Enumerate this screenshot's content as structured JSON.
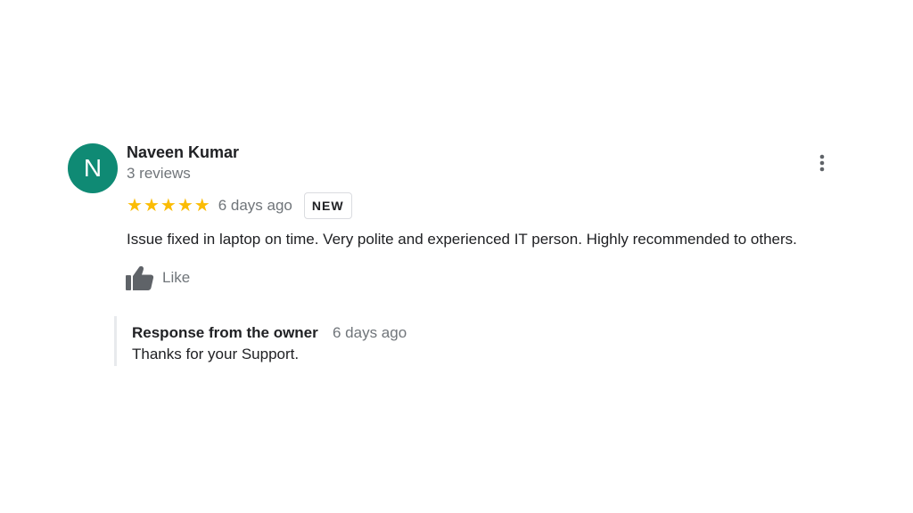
{
  "review": {
    "author": {
      "initial": "N",
      "name": "Naveen Kumar",
      "review_count": "3 reviews",
      "avatar_color": "#0f8a74"
    },
    "rating": {
      "stars": 5,
      "max": 5,
      "star_glyph": "★",
      "star_color": "#fbbc04"
    },
    "time_ago": "6 days ago",
    "badge": "NEW",
    "text": "Issue fixed in laptop on time. Very polite and experienced IT person. Highly recommended to others.",
    "like": {
      "label": "Like",
      "icon": "thumbs-up-icon"
    },
    "more_menu_icon": "more-vert-icon"
  },
  "owner_response": {
    "title": "Response from the owner",
    "time_ago": "6 days ago",
    "text": "Thanks for your Support."
  }
}
